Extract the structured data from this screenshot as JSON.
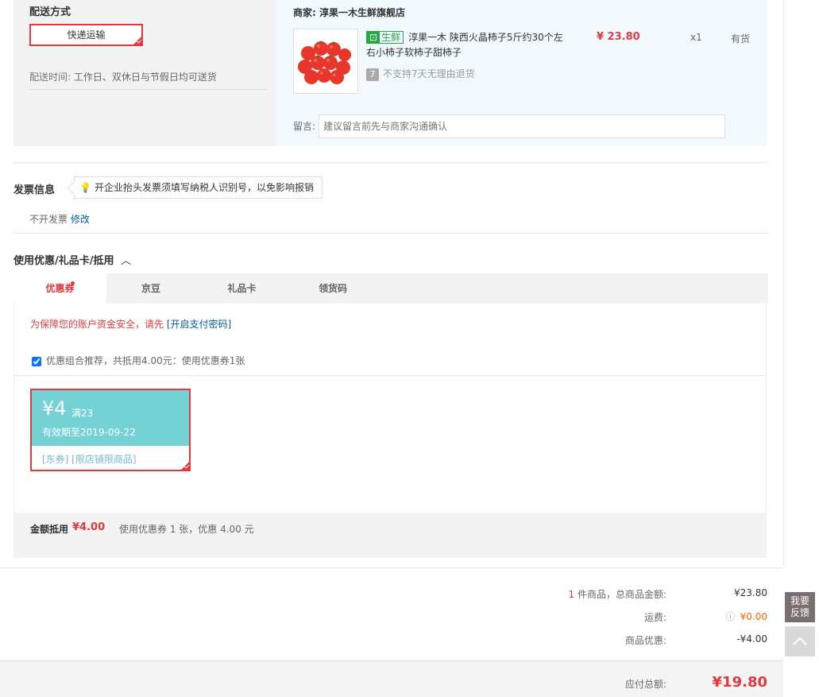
{
  "shipping": {
    "title": "配送方式",
    "method": "快递运输",
    "time_label": "配送时间:",
    "time_value": "工作日、双休日与节假日均可送货"
  },
  "store": {
    "label": "商家:",
    "name": "淳果一木生鲜旗舰店",
    "product": {
      "tag_icon": "ticket-icon",
      "tag_label": "生鲜",
      "title": "淳果一木 陕西火晶柿子5斤约30个左右小柿子软柿子甜柿子",
      "no_return_icon": "7",
      "no_return": "不支持7天无理由退货",
      "price": "¥ 23.80",
      "qty": "x1",
      "stock": "有货"
    },
    "message_label": "留言:",
    "message_placeholder": "建议留言前先与商家沟通确认"
  },
  "invoice": {
    "title": "发票信息",
    "tip": "开企业抬头发票须填写纳税人识别号，以免影响报销",
    "value": "不开发票",
    "edit": "修改"
  },
  "discount": {
    "title": "使用优惠/礼品卡/抵用",
    "tabs": [
      "优惠券",
      "京豆",
      "礼品卡",
      "领货码"
    ],
    "warning_prefix": "为保障您的账户资金安全，请先",
    "warning_link": "[开启支付密码]",
    "combo_text": "优惠组合推荐，共抵用4.00元：使用优惠券1张",
    "coupon": {
      "amount": "¥4",
      "condition": "满23",
      "expiry": "有效期至2019-09-22",
      "tags": "[东券]  [限店铺限商品]"
    },
    "summary_label": "金额抵用",
    "summary_amount": "¥4.00",
    "summary_desc": "使用优惠券 1 张，优惠 4.00 元"
  },
  "totals": {
    "count": "1",
    "goods_label": "件商品，总商品金额:",
    "goods_value": "¥23.80",
    "freight_label": "运费:",
    "freight_value": "¥0.00",
    "discount_label": "商品优惠:",
    "discount_value": "-¥4.00",
    "payable_label": "应付总额:",
    "payable_value": "¥19.80"
  },
  "side": {
    "feedback": "我要反馈"
  }
}
